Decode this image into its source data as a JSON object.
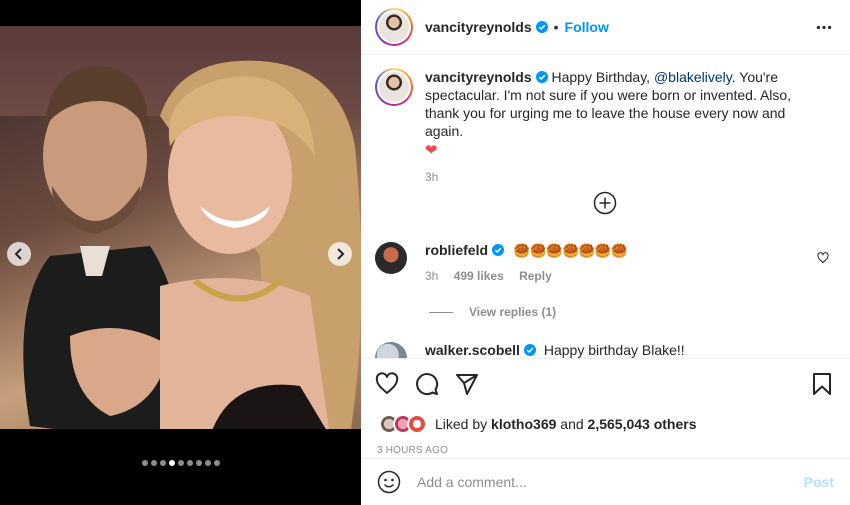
{
  "header": {
    "username": "vancityreynolds",
    "separator": "•",
    "follow_label": "Follow",
    "more_icon": "more-horizontal-icon"
  },
  "caption": {
    "username": "vancityreynolds",
    "text_before": " Happy Birthday, ",
    "mention": "@blakelively",
    "text_after": ". You're spectacular. I'm not sure if you were born or invented. Also, thank you for urging me to leave the house every now and again.",
    "emoji": "❤",
    "time": "3h"
  },
  "comments": [
    {
      "username": "robliefeld",
      "text": "🥮🥮🥮🥮🥮🥮🥮",
      "time": "3h",
      "likes": "499 likes",
      "reply_label": "Reply",
      "view_replies": "View replies (1)"
    },
    {
      "username": "walker.scobell",
      "text": "Happy birthday Blake!!"
    }
  ],
  "likes": {
    "prefix": "Liked by ",
    "user": "klotho369",
    "middle": " and ",
    "count": "2,565,043 others"
  },
  "post_time": "3 HOURS AGO",
  "add_comment": {
    "placeholder": "Add a comment...",
    "post_label": "Post"
  },
  "carousel": {
    "total": 9,
    "active_index": 3
  },
  "colors": {
    "accent": "#0095f6",
    "post_disabled": "#b2dffc",
    "heart": "#ed4956"
  }
}
